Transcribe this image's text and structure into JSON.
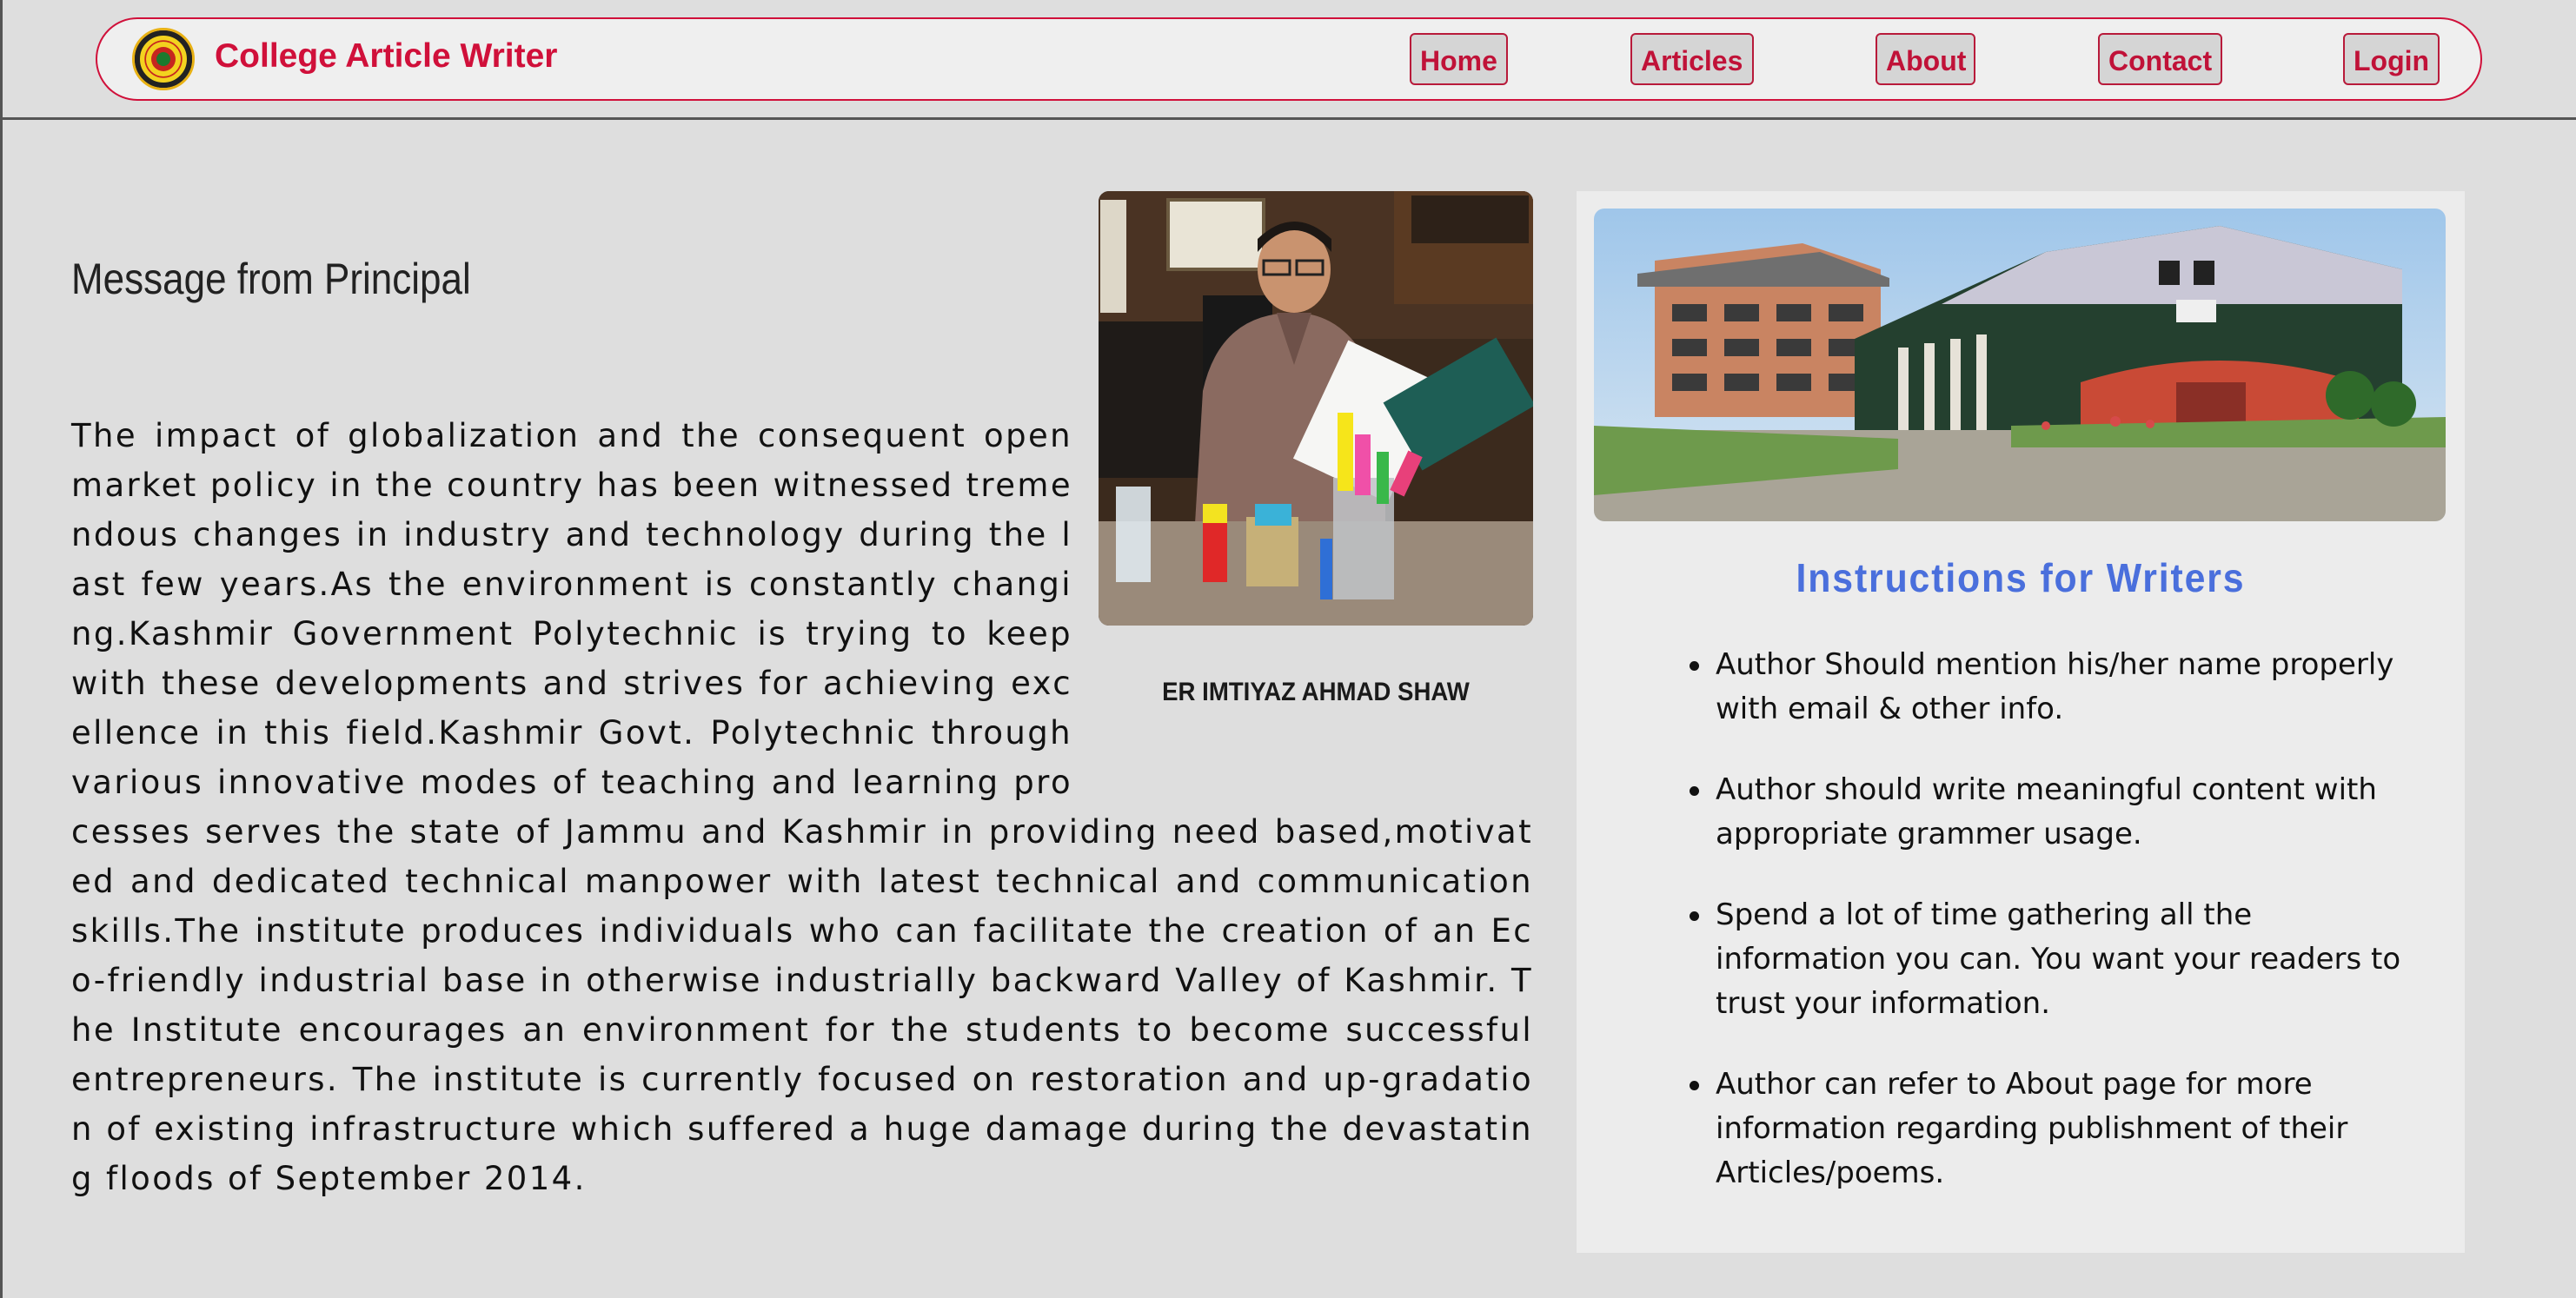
{
  "header": {
    "brand": "College Article Writer",
    "logo_icon": "college-emblem-icon",
    "nav": {
      "home": "Home",
      "articles": "Articles",
      "about": "About",
      "contact": "Contact",
      "login": "Login"
    },
    "accent_color": "#d0103a"
  },
  "principal": {
    "heading": "Message from Principal",
    "name": "ER IMTIYAZ AHMAD SHAW",
    "message": "The impact of globalization and the consequent open market policy in the country has been witnessed tremendous changes in industry and technology during the last few years.As the environment is constantly changing.Kashmir Government Polytechnic is trying to keep with these developments and strives for achieving excellence in this field.Kashmir Govt. Polytechnic through various innovative modes of teaching and learning processes serves the state of Jammu and Kashmir in providing need based,motivated and dedicated technical manpower with latest technical and communication skills.The institute produces individuals who can facilitate the creation of an Eco-friendly industrial base in otherwise industrially backward Valley of Kashmir. The Institute encourages an environment for the students to become successful entrepreneurs. The institute is currently focused on restoration and up-gradation of existing infrastructure which suffered a huge damage during the devastating floods of September 2014."
  },
  "instructions": {
    "title": "Instructions for Writers",
    "title_color": "#4a6fdc",
    "items": [
      "Author Should mention his/her name properly with email & other info.",
      "Author should write meaningful content with appropriate grammer usage.",
      "Spend a lot of time gathering all the information you can. You want your readers to trust your information.",
      "Author can refer to About page for more information regarding publishment of their Articles/poems."
    ]
  }
}
